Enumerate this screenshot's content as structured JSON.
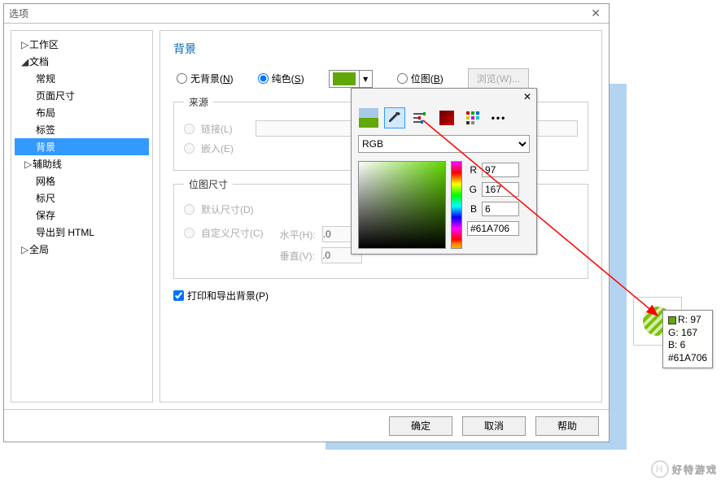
{
  "dialog": {
    "title": "选项",
    "tree": {
      "workspace": "工作区",
      "document": "文档",
      "general": "常规",
      "pagesize": "页面尺寸",
      "layout": "布局",
      "tags": "标签",
      "background": "背景",
      "guides": "辅助线",
      "grid": "网格",
      "ruler": "标尺",
      "save": "保存",
      "export_html": "导出到 HTML",
      "global": "全局"
    },
    "footer": {
      "ok": "确定",
      "cancel": "取消",
      "help": "帮助"
    }
  },
  "panel": {
    "heading": "背景",
    "bg_type": {
      "none": "无背景(N)",
      "none_key": "N",
      "solid": "纯色(S)",
      "solid_key": "S",
      "bitmap": "位图(B)",
      "bitmap_key": "B"
    },
    "browse": "浏览(W)...",
    "source": {
      "legend": "来源",
      "link": "链接(L)",
      "embed": "嵌入(E)"
    },
    "bitmap_size": {
      "legend": "位图尺寸",
      "default": "默认尺寸(D)",
      "custom": "自定义尺寸(C)",
      "horiz": "水平(H):",
      "vert": "垂直(V):",
      "hval": ".0",
      "vval": ".0"
    },
    "print_export": "打印和导出背景(P)"
  },
  "color_picker": {
    "color_hex": "#61A706",
    "mode": "RGB",
    "r_label": "R",
    "r_val": "97",
    "g_label": "G",
    "g_val": "167",
    "b_label": "B",
    "b_val": "6",
    "hex_val": "#61A706"
  },
  "tooltip": {
    "r": "R: 97",
    "g": "G: 167",
    "b": "B: 6",
    "hex": "#61A706"
  },
  "watermark": {
    "text": "好特游戏",
    "icon": "H"
  }
}
